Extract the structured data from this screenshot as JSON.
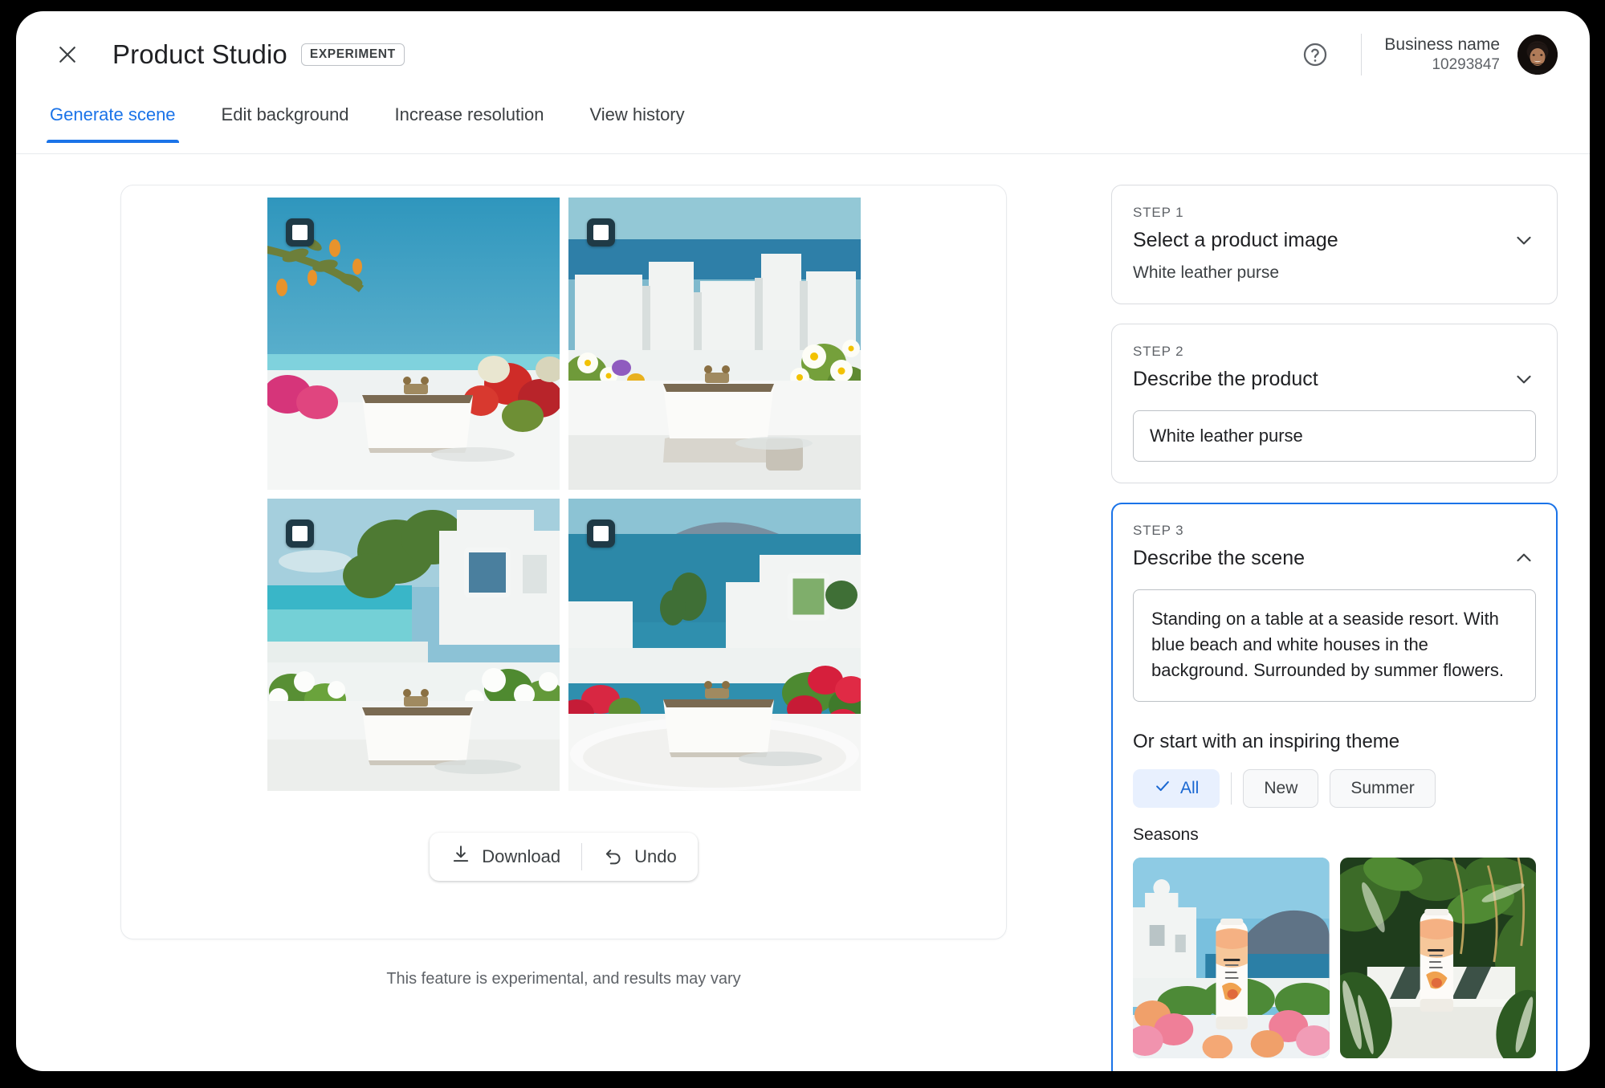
{
  "header": {
    "close_icon": "close-icon",
    "title": "Product Studio",
    "badge": "EXPERIMENT",
    "help_icon": "help-circle-icon",
    "business_name": "Business name",
    "business_id": "10293847",
    "avatar": "user-avatar"
  },
  "tabs": [
    {
      "label": "Generate scene",
      "active": true
    },
    {
      "label": "Edit background",
      "active": false
    },
    {
      "label": "Increase resolution",
      "active": false
    },
    {
      "label": "View history",
      "active": false
    }
  ],
  "results": {
    "images": [
      {
        "alt": "White leather purse on table with olive branch and flowers by the sea",
        "checkbox_checked": false
      },
      {
        "alt": "White leather purse on table with white houses and daisies",
        "checkbox_checked": false
      },
      {
        "alt": "White leather purse on terrace with turquoise beach and white flowers",
        "checkbox_checked": false
      },
      {
        "alt": "White leather purse on marble table with sea, island and red flowers",
        "checkbox_checked": false
      }
    ],
    "download_label": "Download",
    "download_icon": "download-icon",
    "undo_label": "Undo",
    "undo_icon": "undo-arrow-icon",
    "footnote": "This feature is experimental, and results may vary"
  },
  "steps": [
    {
      "kicker": "STEP 1",
      "title": "Select a product image",
      "subtitle": "White leather purse",
      "chevron": "chevron-down-icon",
      "expanded": false
    },
    {
      "kicker": "STEP 2",
      "title": "Describe the product",
      "chevron": "chevron-down-icon",
      "expanded": true,
      "field_value": "White leather purse"
    },
    {
      "kicker": "STEP 3",
      "title": "Describe the scene",
      "chevron": "chevron-up-icon",
      "expanded": true,
      "active": true,
      "field_value": "Standing on a table at a seaside resort. With blue beach and white houses in the background. Surrounded by summer flowers.",
      "theme_label": "Or start with an inspiring theme",
      "chips": [
        {
          "label": "All",
          "selected": true,
          "icon": "check-icon"
        },
        {
          "label": "New",
          "selected": false
        },
        {
          "label": "Summer",
          "selected": false
        }
      ],
      "group_label": "Seasons",
      "theme_thumbs": [
        {
          "alt": "eBalm tube on white ledge with pink flowers, white houses and blue sea"
        },
        {
          "alt": "eBalm tube on ledge amid large green tropical leaves"
        }
      ]
    }
  ],
  "colors": {
    "accent": "#1a73e8",
    "accent_soft": "#e8f0fe",
    "text_primary": "#202124",
    "text_secondary": "#5f6368",
    "border": "#dadce0"
  }
}
